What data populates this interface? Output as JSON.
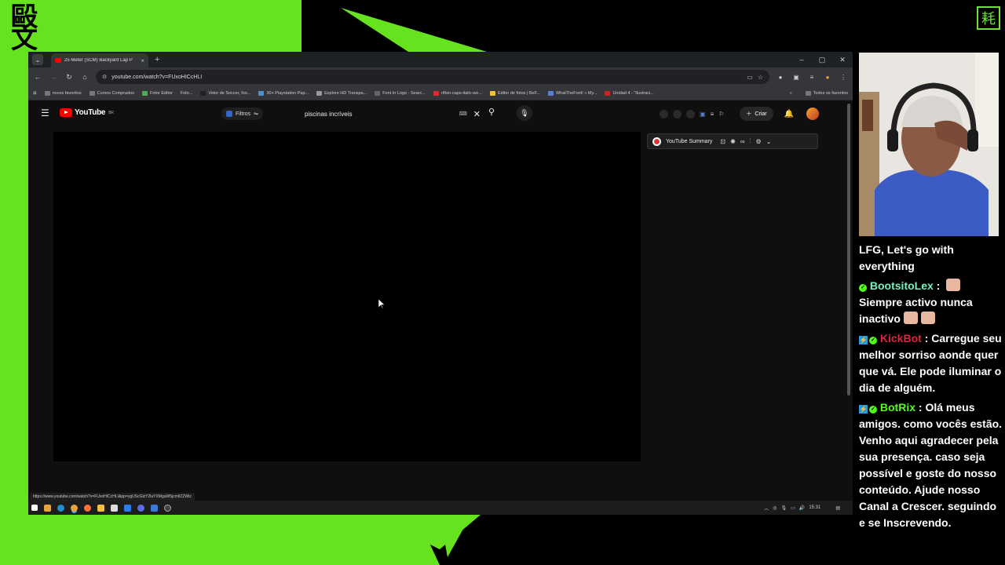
{
  "overlay": {
    "corner_glyph": "毆\n文",
    "badge_glyph": "耗",
    "accent_green": "#67e21f"
  },
  "browser": {
    "tab_title": "25 Meter (SCM) Backyard Lap P",
    "tab_close": "×",
    "new_tab": "+",
    "window_controls": [
      "–",
      "▢",
      "✕"
    ],
    "url": "youtube.com/watch?v=FUxoHICcHLI",
    "bookmarks": [
      "novos favoritos",
      "Cursos Comprados",
      "Fotor Editor",
      "Foto...",
      "Vetor de Soccer, foo...",
      "30+ Playstation Pap...",
      "Explore HD Transpa...",
      "Font In Logo - Searc...",
      "rifton-caps-italic-we...",
      "Editor de fotos | BeF...",
      "WhatTheFont! « My...",
      "Unidad 4 - \"Ilustraci..."
    ],
    "bookmarks_more": "»",
    "bookmarks_all": "Todos os favoritos",
    "status_url": "https://www.youtube.com/watch?v=FUxoHICcHLI&pp=ygUScGlzY2luYXMgaW5jcmIlZZWlz"
  },
  "youtube": {
    "logo_text": "YouTube",
    "country": "BR",
    "filter_label": "Filtros",
    "search_query": "piscinas incríveis",
    "create_label": "Criar",
    "summary_label": "YouTube Summary"
  },
  "taskbar": {
    "time": "15:31"
  },
  "chat": {
    "messages": [
      {
        "user": "",
        "text": "LFG, Let's go with everything"
      },
      {
        "user": "BootsitoLex",
        "sep": " : ",
        "text": "Siempre activo nunca inactivo"
      },
      {
        "user": "KickBot",
        "sep": " : ",
        "text": "Carregue seu melhor sorriso aonde quer que vá. Ele pode iluminar o dia de alguém."
      },
      {
        "user": "BotRix",
        "sep": " : ",
        "text": "Olá meus amigos. como vocês estão. Venho aqui agradecer pela sua presença. caso seja possível e goste do nosso conteúdo. Ajude nosso Canal a Crescer. seguindo e se Inscrevendo."
      }
    ]
  }
}
